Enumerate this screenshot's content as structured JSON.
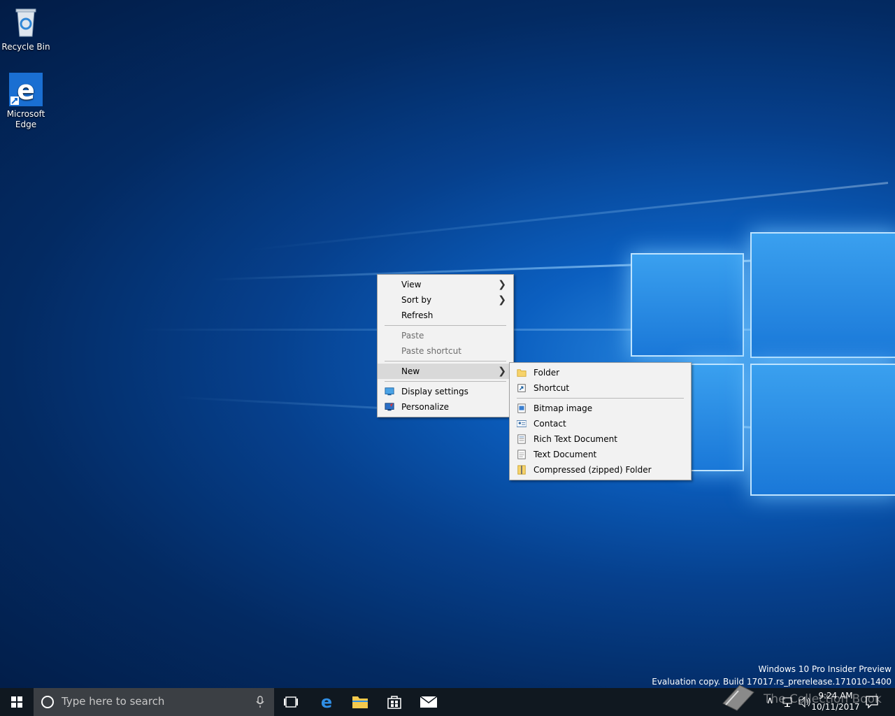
{
  "desktop_icons": {
    "recycle_bin": "Recycle Bin",
    "edge": "Microsoft Edge"
  },
  "context_menu": {
    "view": "View",
    "sort_by": "Sort by",
    "refresh": "Refresh",
    "paste": "Paste",
    "paste_shortcut": "Paste shortcut",
    "new": "New",
    "display_settings": "Display settings",
    "personalize": "Personalize"
  },
  "new_submenu": {
    "folder": "Folder",
    "shortcut": "Shortcut",
    "bitmap": "Bitmap image",
    "contact": "Contact",
    "rich_text": "Rich Text Document",
    "text_doc": "Text Document",
    "zip": "Compressed (zipped) Folder"
  },
  "watermark": {
    "line1": "Windows 10 Pro Insider Preview",
    "line2": "Evaluation copy. Build 17017.rs_prerelease.171010-1400"
  },
  "taskbar": {
    "search_placeholder": "Type here to search",
    "time": "9:24 AM",
    "date": "10/11/2017",
    "overlay_text": "The Collection Book"
  },
  "colors": {
    "menu_bg": "#f2f2f2",
    "taskbar_bg": "#101820",
    "accent": "#0078d7"
  }
}
